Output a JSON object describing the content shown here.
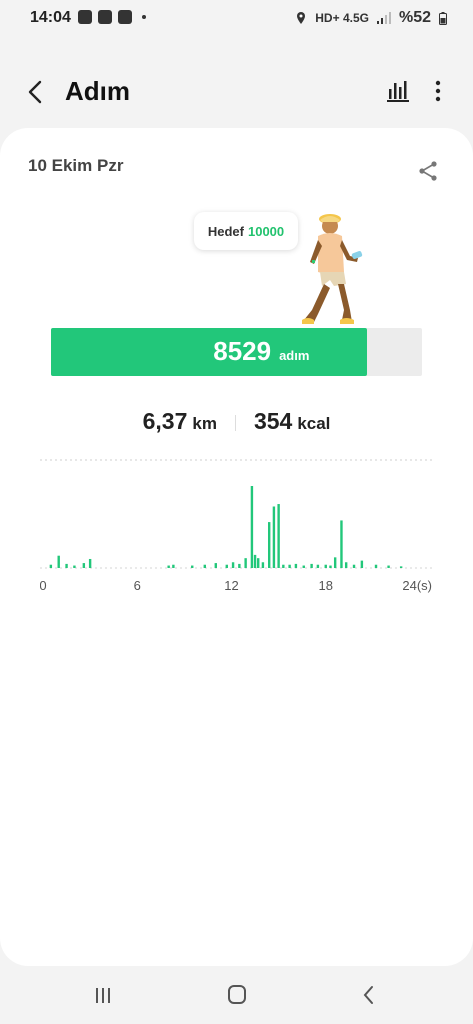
{
  "status_bar": {
    "time": "14:04",
    "network": "HD+ 4.5G",
    "battery": "%52"
  },
  "header": {
    "title": "Adım"
  },
  "summary": {
    "date": "10 Ekim Pzr",
    "goal_label": "Hedef",
    "goal_value": "10000",
    "steps": "8529",
    "steps_unit": "adım",
    "progress_fraction": 0.8529,
    "distance": "6,37",
    "distance_unit": "km",
    "calories": "354",
    "calories_unit": "kcal"
  },
  "colors": {
    "accent": "#22c77a",
    "track": "#ececec"
  },
  "chart_data": {
    "type": "bar",
    "xlabel": "",
    "ylabel": "",
    "x_ticks": [
      "0",
      "6",
      "12",
      "18",
      "24(s)"
    ],
    "xlim": [
      0,
      24
    ],
    "ylim": [
      0,
      1
    ],
    "grid": "dotted top line",
    "x": [
      0.5,
      1.0,
      1.5,
      2.0,
      2.6,
      3.0,
      8.0,
      8.3,
      9.5,
      10.3,
      11.0,
      11.7,
      12.1,
      12.5,
      12.9,
      13.3,
      13.5,
      13.7,
      14.0,
      14.4,
      14.7,
      15.0,
      15.3,
      15.7,
      16.1,
      16.6,
      17.1,
      17.5,
      18.0,
      18.3,
      18.6,
      19.0,
      19.3,
      19.8,
      20.3,
      21.2,
      22.0,
      22.8
    ],
    "values": [
      0.04,
      0.15,
      0.05,
      0.03,
      0.06,
      0.11,
      0.03,
      0.04,
      0.03,
      0.04,
      0.06,
      0.04,
      0.07,
      0.05,
      0.12,
      1.0,
      0.16,
      0.12,
      0.07,
      0.56,
      0.75,
      0.78,
      0.04,
      0.04,
      0.05,
      0.03,
      0.05,
      0.04,
      0.04,
      0.03,
      0.13,
      0.58,
      0.07,
      0.04,
      0.09,
      0.04,
      0.03,
      0.02
    ]
  }
}
